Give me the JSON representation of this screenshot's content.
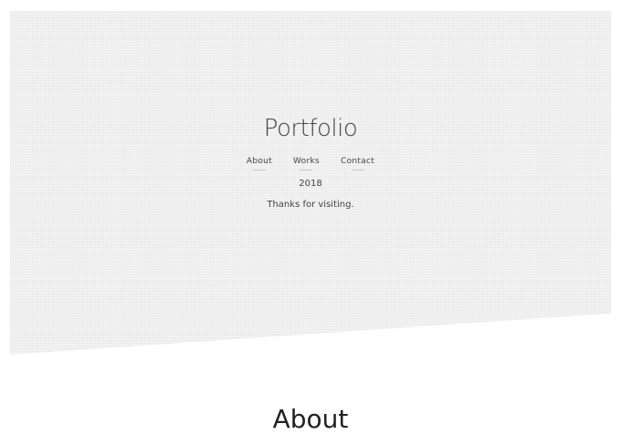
{
  "hero": {
    "title": "Portfolio",
    "nav": [
      {
        "label": "About"
      },
      {
        "label": "Works"
      },
      {
        "label": "Contact"
      }
    ],
    "year": "2018",
    "message": "Thanks for visiting."
  },
  "about": {
    "heading": "About"
  },
  "colors": {
    "hero_background": "#f3f3f3",
    "text": "#444444",
    "heading": "#222222"
  }
}
